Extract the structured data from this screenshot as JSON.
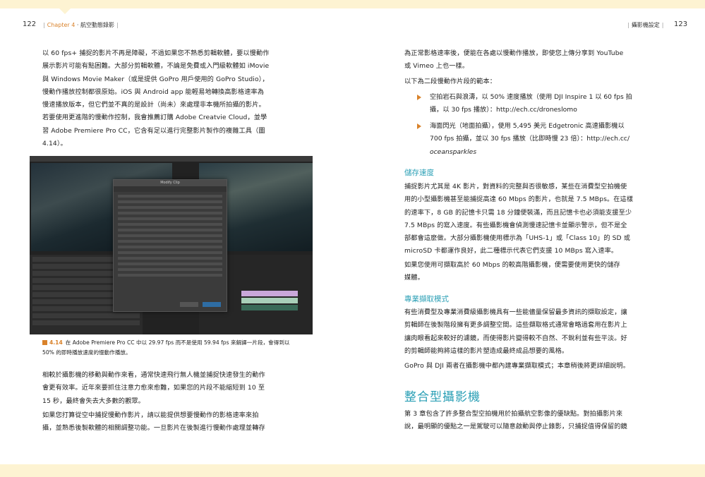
{
  "left_page": {
    "page_number": "122",
    "chapter": "Chapter 4",
    "chapter_title": "航空動態錄影",
    "para1": [
      "以 60 fps+ 捕捉的影片不再是障礙，不過如果您不熟悉剪輯軟體，要以慢動作",
      "展示影片可能有點困難。大部分剪輯軟體，不論是免費或入門級軟體如 iMovie",
      "與 Windows Movie Maker（或是提供 GoPro 用戶使用的 GoPro Studio），",
      "慢動作播放控制都很原始。iOS 與 Android app 能輕易地轉換高影格速率為",
      "慢速播放版本，但它們並不真的是設計（尚未）來處理非本機所拍攝的影片。",
      "若要使用更進階的慢動作控制，我會推薦訂購 Adobe Creatvie Cloud，並學",
      "習 Adobe Premiere Pro CC，它含有足以進行完整影片製作的複雜工具（圖",
      "4.14）。"
    ],
    "figure": {
      "number": "4.14",
      "caption_lines": [
        "在 Adobe Premiere Pro CC 中以 29.97 fps 而不是使用 59.94 fps 來解譯一片段，會得到以",
        "50% 的即時播放速度的慢動作播放。"
      ],
      "dialog_title": "Modify Clip"
    },
    "para2": [
      "相較於攝影機的移動與動作來看，通常快速飛行無人機並捕捉快速發生的動作",
      "會更有效率。近年來要抓住注意力愈來愈難，如果您的片段不能縮短到 10 至",
      "15 秒，最終會失去大多數的觀眾。"
    ],
    "para3": [
      "如果您打算從空中捕捉慢動作影片，請以能提供想要慢動作的影格速率來拍",
      "攝，並熟悉後製軟體的相關調整功能。一旦影片在後製進行慢動作處理並轉存"
    ]
  },
  "right_page": {
    "page_number": "123",
    "section_runner": "攝影機設定",
    "para1": [
      "為正常影格速率後，便能在各處以慢動作播放，即使您上傳分享到 YouTube",
      "或 Vimeo 上也一樣。"
    ],
    "para2": "以下為二段慢動作片段的範本：",
    "bullets": [
      [
        "空拍岩石與浪濤，以 50% 速度播放（使用 DJI Inspire 1 以 60 fps 拍",
        "攝，以 30 fps 播放）：http://ech.cc/droneslomo"
      ],
      [
        "海面閃光（地面拍攝），使用 5,495 美元 Edgetronic 高速攝影機以",
        "700 fps 拍攝，並以 30 fps 播放（比即時慢 23 倍）：http://ech.cc/",
        "oceansparkles"
      ]
    ],
    "heading_storage": "儲存速度",
    "storage_para1": [
      "捕捉影片尤其是 4K 影片，對資料的完整與否很敏感，某些在消費型空拍機使",
      "用的小型攝影機甚至能捕捉高達 60 Mbps 的影片，也就是 7.5 MBps。在這樣",
      "的速率下，8 GB 的記憶卡只需 18 分鐘便裝滿，而且記憶卡也必須能支援至少",
      "7.5 MBps 的寫入速度。有些攝影機會偵測慢速記憶卡並顯示警示，但不是全",
      "部都會這麼做。大部分攝影機使用標示為「UHS-1」或「Class 10」的 SD 或",
      "microSD 卡都運作良好，此二種標示代表它們支援 10 MBps 寫入速率。"
    ],
    "storage_para2": [
      "如果您使用可擷取高於 60 Mbps 的較高階攝影機，便需要使用更快的儲存",
      "媒體。"
    ],
    "heading_pro": "專業擷取模式",
    "pro_para1": [
      "有些消費型及專業消費級攝影機具有一些能儘量保留最多資訊的擷取設定，讓",
      "剪輯師在後製階段擁有更多調整空間。這些擷取格式通常會略過套用在影片上",
      "讓肉眼看起來較好的濾鏡，而使得影片變得較不自然、不銳利並有些平淡。好",
      "的剪輯師能夠將這樣的影片塑造成最終成品想要的風格。"
    ],
    "pro_para2": "GoPro 與 DJI 兩者在攝影機中都內建專業擷取模式；本章稍後將更詳細說明。",
    "big_heading": "整合型攝影機",
    "final_para": [
      "第 3 章包含了許多整合型空拍機用於拍攝航空影像的優缺點。對拍攝影片來",
      "說，最明顯的優點之一是駕駛可以隨意啟動與停止錄影，只捕捉值得保留的鏡"
    ]
  },
  "colors": {
    "accent_orange": "#d9822b",
    "heading_teal": "#2a9fb5",
    "strip_cream": "#fdf3d2"
  }
}
